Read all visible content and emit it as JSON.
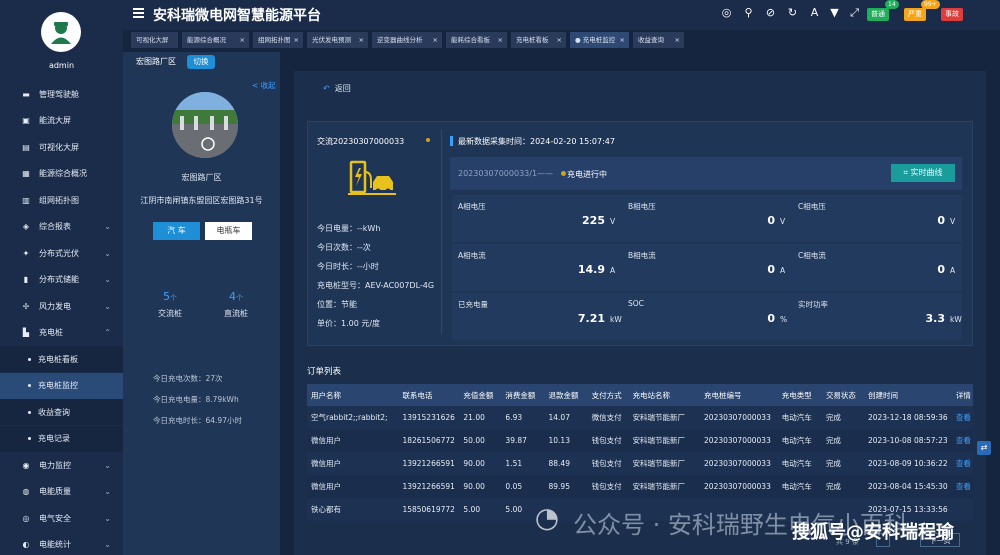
{
  "app": {
    "title": "安科瑞微电网智慧能源平台",
    "user": "admin"
  },
  "topbar": {
    "badges": [
      {
        "label": "普通",
        "count": "14",
        "color": "#1fae5a",
        "count_color": "#1fae5a"
      },
      {
        "label": "严重",
        "count": "99+",
        "color": "#f2a51b",
        "count_color": "#f2a51b"
      },
      {
        "label": "事故",
        "color": "#e03c3c"
      }
    ],
    "icons": [
      "gauge-icon",
      "search-icon",
      "mute-icon",
      "refresh-icon",
      "font-icon",
      "shirt-icon",
      "fullscreen-icon"
    ]
  },
  "sidebar": {
    "items": [
      {
        "label": "管理驾驶舱",
        "icon": "monitor-icon"
      },
      {
        "label": "能流大屏",
        "icon": "screen-icon"
      },
      {
        "label": "可视化大屏",
        "icon": "chart-icon"
      },
      {
        "label": "能源综合概况",
        "icon": "overview-icon"
      },
      {
        "label": "组网拓扑图",
        "icon": "topology-icon"
      },
      {
        "label": "综合报表",
        "icon": "report-icon",
        "arrow": "⌄"
      },
      {
        "label": "分布式光伏",
        "icon": "solar-icon",
        "arrow": "⌄"
      },
      {
        "label": "分布式储能",
        "icon": "storage-icon",
        "arrow": "⌄"
      },
      {
        "label": "风力发电",
        "icon": "wind-icon",
        "arrow": "⌄"
      },
      {
        "label": "充电桩",
        "icon": "charger-icon",
        "arrow": "⌃"
      }
    ],
    "sub_items": [
      {
        "label": "充电桩看板"
      },
      {
        "label": "充电桩监控",
        "active": true
      },
      {
        "label": "收益查询"
      },
      {
        "label": "充电记录"
      }
    ],
    "items_after": [
      {
        "label": "电力监控",
        "icon": "power-icon",
        "arrow": "⌄"
      },
      {
        "label": "电能质量",
        "icon": "quality-icon",
        "arrow": "⌄"
      },
      {
        "label": "电气安全",
        "icon": "safety-icon",
        "arrow": "⌄"
      },
      {
        "label": "电能统计",
        "icon": "stats-icon",
        "arrow": "⌄"
      }
    ]
  },
  "tabs": [
    {
      "label": "可视化大屏"
    },
    {
      "label": "能源综合概况",
      "close": "×"
    },
    {
      "label": "组网拓扑图",
      "close": "×"
    },
    {
      "label": "光伏发电预测",
      "close": "×"
    },
    {
      "label": "逆变器曲线分析",
      "close": "×"
    },
    {
      "label": "能耗综合看板",
      "close": "×"
    },
    {
      "label": "充电桩看板",
      "close": "×"
    },
    {
      "label": "● 充电桩监控",
      "close": "×",
      "active": true
    },
    {
      "label": "收益查询",
      "close": "×"
    }
  ],
  "station": {
    "name": "宏图路厂区",
    "switch_label": "切换",
    "collapse_label": "< 收起",
    "label": "宏图路厂区",
    "address": "江阴市南闸镇东盟园区宏图路31号",
    "car_tab": "汽 车",
    "ebike_tab": "电瓶车",
    "ac_count": "5",
    "ac_unit": "个",
    "ac_label": "交流桩",
    "dc_count": "4",
    "dc_unit": "个",
    "dc_label": "直流桩",
    "today_times": "今日充电次数：27次",
    "today_energy": "今日充电电量：8.79kWh",
    "today_duration": "今日充电时长：64.97小时"
  },
  "main": {
    "back_label": "返回",
    "charger_id": "交流20230307000033",
    "info": [
      "今日电量：--kWh",
      "今日次数：--次",
      "今日时长：--小时",
      "充电桩型号：AEV-AC007DL-4G",
      "位置：节能",
      "单价：1.00 元/度"
    ],
    "sample_time": "最新数据采集时间：2024-02-20 15:07:47",
    "status_prefix": "20230307000033/1——",
    "status_label": "充电进行中",
    "curve_button": "实时曲线",
    "metrics": [
      {
        "label": "A相电压",
        "value": "225",
        "unit": "V"
      },
      {
        "label": "B相电压",
        "value": "0",
        "unit": "V"
      },
      {
        "label": "C相电压",
        "value": "0",
        "unit": "V"
      },
      {
        "label": "A相电流",
        "value": "14.9",
        "unit": "A"
      },
      {
        "label": "B相电流",
        "value": "0",
        "unit": "A"
      },
      {
        "label": "C相电流",
        "value": "0",
        "unit": "A"
      },
      {
        "label": "已充电量",
        "value": "7.21",
        "unit": "kWh"
      },
      {
        "label": "SOC",
        "value": "0",
        "unit": "%"
      },
      {
        "label": "实时功率",
        "value": "3.3",
        "unit": "kW"
      }
    ]
  },
  "orders": {
    "title": "订单列表",
    "columns": [
      "用户名称",
      "联系电话",
      "充值金额",
      "消费金额",
      "退款金额",
      "支付方式",
      "充电站名称",
      "充电桩编号",
      "充电类型",
      "交易状态",
      "创建时间",
      "详情"
    ],
    "rows": [
      [
        "空气rabbit2;;rabbit2;",
        "13915231626",
        "21.00",
        "6.93",
        "14.07",
        "微信支付",
        "安科瑞节能新厂",
        "20230307000033",
        "电动汽车",
        "完成",
        "2023-12-18 08:59:36",
        "查看"
      ],
      [
        "微信用户",
        "18261506772",
        "50.00",
        "39.87",
        "10.13",
        "钱包支付",
        "安科瑞节能新厂",
        "20230307000033",
        "电动汽车",
        "完成",
        "2023-10-08 08:57:23",
        "查看"
      ],
      [
        "微信用户",
        "13921266591",
        "90.00",
        "1.51",
        "88.49",
        "钱包支付",
        "安科瑞节能新厂",
        "20230307000033",
        "电动汽车",
        "完成",
        "2023-08-09 10:36:22",
        "查看"
      ],
      [
        "微信用户",
        "13921266591",
        "90.00",
        "0.05",
        "89.95",
        "钱包支付",
        "安科瑞节能新厂",
        "20230307000033",
        "电动汽车",
        "完成",
        "2023-08-04 15:45:30",
        "查看"
      ],
      [
        "铁心都有",
        "15850619772",
        "5.00",
        "5.00",
        "",
        "",
        "",
        "",
        "",
        "",
        "2023-07-15 13:33:56",
        ""
      ]
    ]
  },
  "pager": {
    "total": "共 9 条",
    "next": "下一页"
  },
  "watermark": {
    "text1": "公众号 · 安科瑞野生电气小百科",
    "text2": "搜狐号@安科瑞程瑜"
  }
}
